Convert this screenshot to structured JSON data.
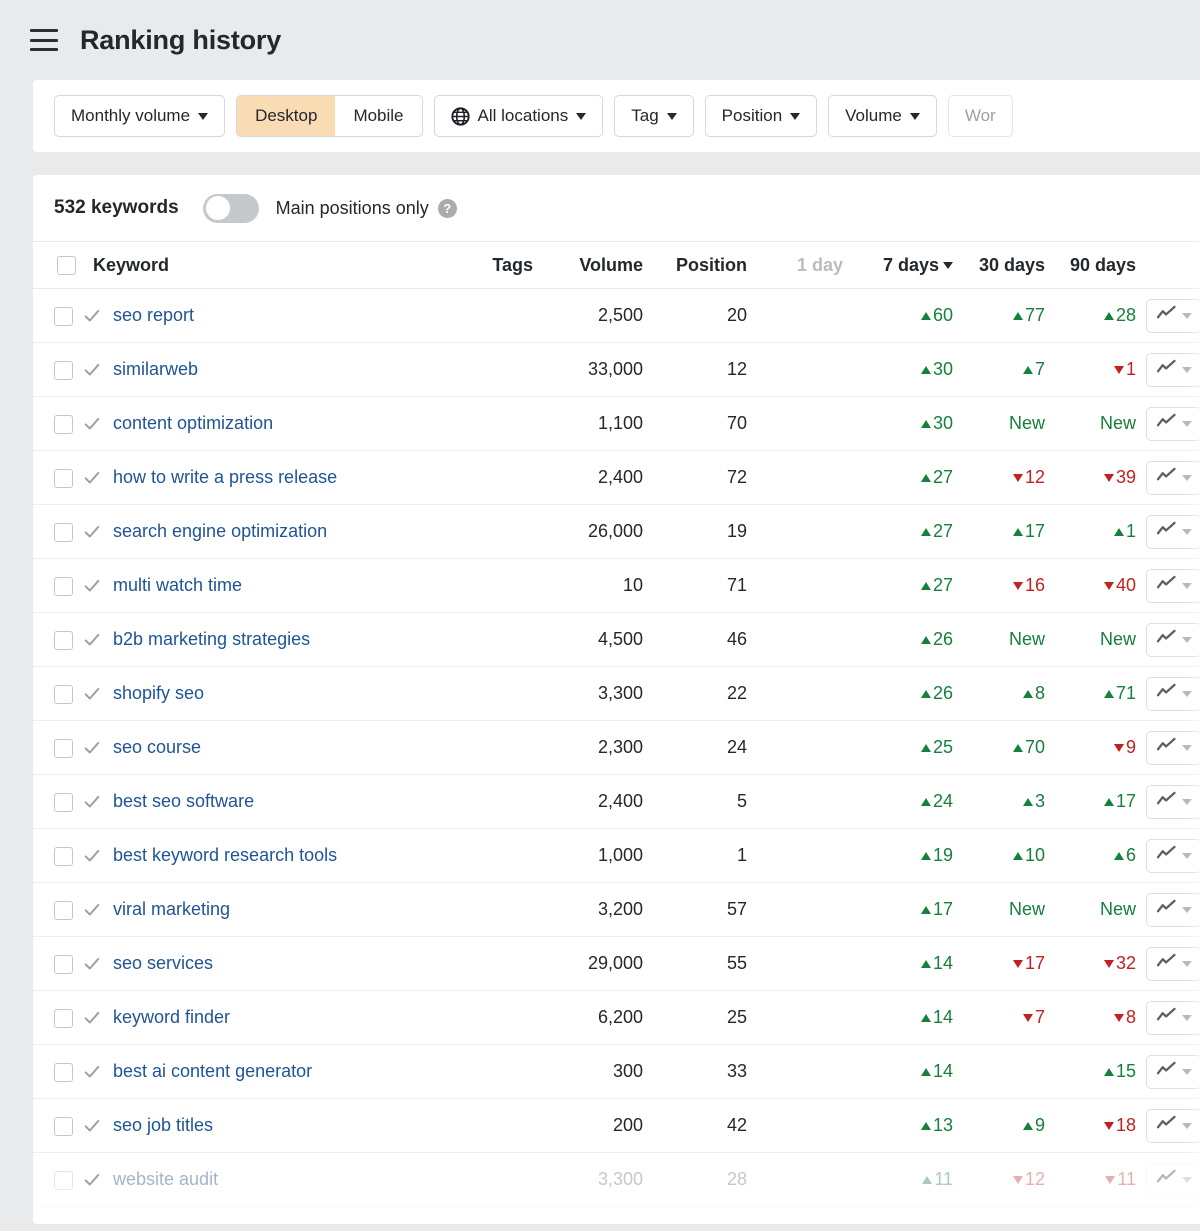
{
  "header": {
    "menu_icon": "hamburger-icon",
    "title": "Ranking history"
  },
  "filters": {
    "volume_mode": "Monthly volume",
    "device": {
      "options": [
        "Desktop",
        "Mobile"
      ],
      "selected": "Desktop"
    },
    "location": {
      "icon": "globe-icon",
      "label": "All locations"
    },
    "tag": "Tag",
    "position": "Position",
    "volume": "Volume",
    "words_truncated": "Wor"
  },
  "toolbar": {
    "keyword_count": "532 keywords",
    "main_positions_label": "Main positions only",
    "main_positions_enabled": false,
    "help_icon": "?"
  },
  "table": {
    "columns": {
      "keyword": "Keyword",
      "tags": "Tags",
      "volume": "Volume",
      "position": "Position",
      "d1": "1 day",
      "d7": "7 days",
      "d30": "30 days",
      "d90": "90 days"
    },
    "sorted_by": "7 days",
    "rows": [
      {
        "keyword": "seo report",
        "tags": "",
        "volume": "2,500",
        "position": "20",
        "d1": "",
        "d7": {
          "dir": "up",
          "value": "60"
        },
        "d30": {
          "dir": "up",
          "value": "77"
        },
        "d90": {
          "dir": "up",
          "value": "28"
        }
      },
      {
        "keyword": "similarweb",
        "tags": "",
        "volume": "33,000",
        "position": "12",
        "d1": "",
        "d7": {
          "dir": "up",
          "value": "30"
        },
        "d30": {
          "dir": "up",
          "value": "7"
        },
        "d90": {
          "dir": "down",
          "value": "1"
        }
      },
      {
        "keyword": "content optimization",
        "tags": "",
        "volume": "1,100",
        "position": "70",
        "d1": "",
        "d7": {
          "dir": "up",
          "value": "30"
        },
        "d30": {
          "dir": "new",
          "value": "New"
        },
        "d90": {
          "dir": "new",
          "value": "New"
        }
      },
      {
        "keyword": "how to write a press release",
        "tags": "",
        "volume": "2,400",
        "position": "72",
        "d1": "",
        "d7": {
          "dir": "up",
          "value": "27"
        },
        "d30": {
          "dir": "down",
          "value": "12"
        },
        "d90": {
          "dir": "down",
          "value": "39"
        }
      },
      {
        "keyword": "search engine optimization",
        "tags": "",
        "volume": "26,000",
        "position": "19",
        "d1": "",
        "d7": {
          "dir": "up",
          "value": "27"
        },
        "d30": {
          "dir": "up",
          "value": "17"
        },
        "d90": {
          "dir": "up",
          "value": "1"
        }
      },
      {
        "keyword": "multi watch time",
        "tags": "",
        "volume": "10",
        "position": "71",
        "d1": "",
        "d7": {
          "dir": "up",
          "value": "27"
        },
        "d30": {
          "dir": "down",
          "value": "16"
        },
        "d90": {
          "dir": "down",
          "value": "40"
        }
      },
      {
        "keyword": "b2b marketing strategies",
        "tags": "",
        "volume": "4,500",
        "position": "46",
        "d1": "",
        "d7": {
          "dir": "up",
          "value": "26"
        },
        "d30": {
          "dir": "new",
          "value": "New"
        },
        "d90": {
          "dir": "new",
          "value": "New"
        }
      },
      {
        "keyword": "shopify seo",
        "tags": "",
        "volume": "3,300",
        "position": "22",
        "d1": "",
        "d7": {
          "dir": "up",
          "value": "26"
        },
        "d30": {
          "dir": "up",
          "value": "8"
        },
        "d90": {
          "dir": "up",
          "value": "71"
        }
      },
      {
        "keyword": "seo course",
        "tags": "",
        "volume": "2,300",
        "position": "24",
        "d1": "",
        "d7": {
          "dir": "up",
          "value": "25"
        },
        "d30": {
          "dir": "up",
          "value": "70"
        },
        "d90": {
          "dir": "down",
          "value": "9"
        }
      },
      {
        "keyword": "best seo software",
        "tags": "",
        "volume": "2,400",
        "position": "5",
        "d1": "",
        "d7": {
          "dir": "up",
          "value": "24"
        },
        "d30": {
          "dir": "up",
          "value": "3"
        },
        "d90": {
          "dir": "up",
          "value": "17"
        }
      },
      {
        "keyword": "best keyword research tools",
        "tags": "",
        "volume": "1,000",
        "position": "1",
        "d1": "",
        "d7": {
          "dir": "up",
          "value": "19"
        },
        "d30": {
          "dir": "up",
          "value": "10"
        },
        "d90": {
          "dir": "up",
          "value": "6"
        }
      },
      {
        "keyword": "viral marketing",
        "tags": "",
        "volume": "3,200",
        "position": "57",
        "d1": "",
        "d7": {
          "dir": "up",
          "value": "17"
        },
        "d30": {
          "dir": "new",
          "value": "New"
        },
        "d90": {
          "dir": "new",
          "value": "New"
        }
      },
      {
        "keyword": "seo services",
        "tags": "",
        "volume": "29,000",
        "position": "55",
        "d1": "",
        "d7": {
          "dir": "up",
          "value": "14"
        },
        "d30": {
          "dir": "down",
          "value": "17"
        },
        "d90": {
          "dir": "down",
          "value": "32"
        }
      },
      {
        "keyword": "keyword finder",
        "tags": "",
        "volume": "6,200",
        "position": "25",
        "d1": "",
        "d7": {
          "dir": "up",
          "value": "14"
        },
        "d30": {
          "dir": "down",
          "value": "7"
        },
        "d90": {
          "dir": "down",
          "value": "8"
        }
      },
      {
        "keyword": "best ai content generator",
        "tags": "",
        "volume": "300",
        "position": "33",
        "d1": "",
        "d7": {
          "dir": "up",
          "value": "14"
        },
        "d30": {
          "dir": "none",
          "value": ""
        },
        "d90": {
          "dir": "up",
          "value": "15"
        }
      },
      {
        "keyword": "seo job titles",
        "tags": "",
        "volume": "200",
        "position": "42",
        "d1": "",
        "d7": {
          "dir": "up",
          "value": "13"
        },
        "d30": {
          "dir": "up",
          "value": "9"
        },
        "d90": {
          "dir": "down",
          "value": "18"
        }
      },
      {
        "keyword": "website audit",
        "tags": "",
        "volume": "3,300",
        "position": "28",
        "d1": "",
        "d7": {
          "dir": "up",
          "value": "11"
        },
        "d30": {
          "dir": "down",
          "value": "12"
        },
        "d90": {
          "dir": "down",
          "value": "11"
        },
        "faded": true
      }
    ]
  },
  "colors": {
    "accent": "#fadcb4",
    "link": "#1f5496",
    "up": "#16803c",
    "down": "#c32121",
    "page_bg": "#e9eaec"
  }
}
